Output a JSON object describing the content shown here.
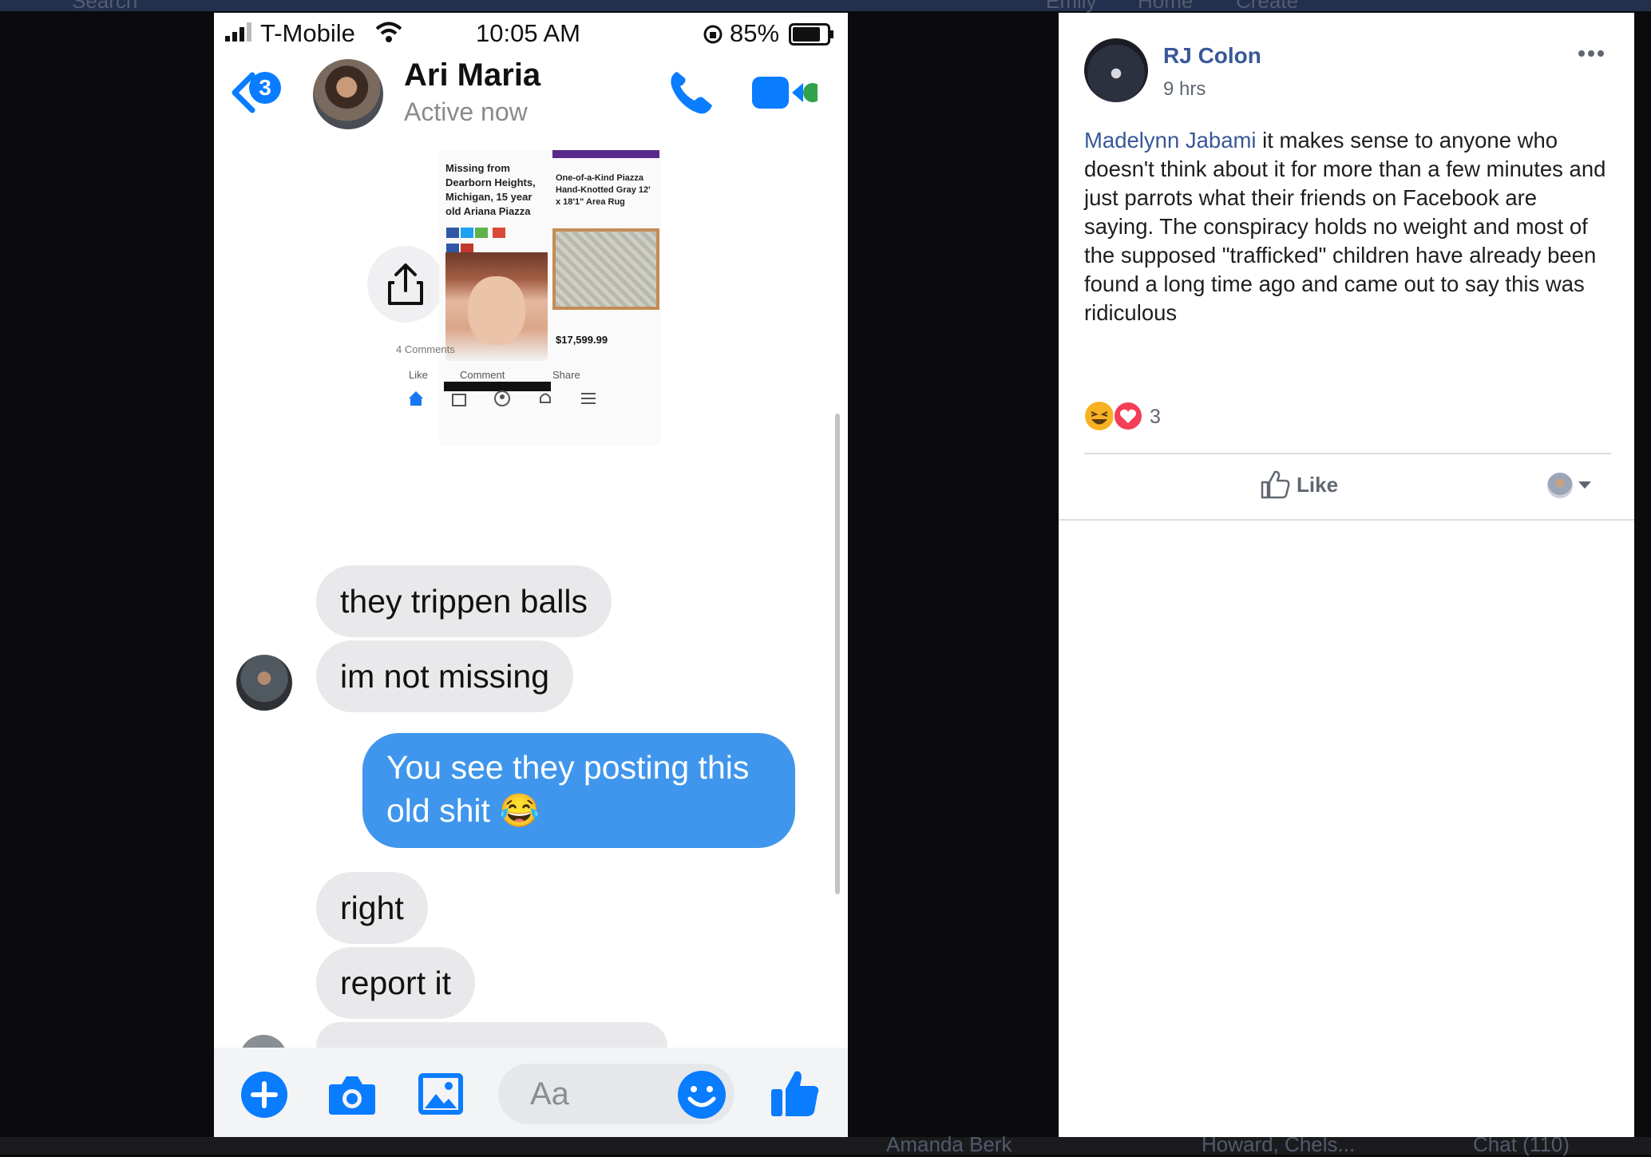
{
  "background": {
    "top_labels": [
      "Search",
      "Emily",
      "Home",
      "Create"
    ],
    "bottom_labels": [
      "Amanda Berk",
      "Howard, Chels...",
      "Chat (110)"
    ]
  },
  "phone": {
    "status": {
      "carrier": "T-Mobile",
      "time": "10:05 AM",
      "battery": "85%"
    },
    "header": {
      "back_badge": "3",
      "contact_name": "Ari Maria",
      "contact_status": "Active now"
    },
    "shared_post": {
      "left_headline": "Missing from Dearborn Heights, Michigan, 15 year old Ariana Piazza",
      "product_title": "One-of-a-Kind Piazza Hand-Knotted Gray 12' x 18'1\" Area Rug",
      "price": "$17,599.99",
      "comments": "4 Comments",
      "actions": [
        "Like",
        "Comment",
        "Share"
      ]
    },
    "messages": [
      {
        "dir": "in",
        "text": "they trippen balls"
      },
      {
        "dir": "in",
        "text": "im not missing"
      },
      {
        "dir": "out",
        "text": "You see they posting this old shit 😂"
      },
      {
        "dir": "in",
        "text": "right"
      },
      {
        "dir": "in",
        "text": "report it"
      }
    ],
    "composer": {
      "placeholder": "Aa"
    },
    "colors": {
      "accent": "#0a7cff",
      "outgoing_bubble": "#3f96ec",
      "incoming_bubble": "#e9e9eb",
      "online": "#31a24c"
    }
  },
  "fb_comment": {
    "author": "RJ Colon",
    "time": "9 hrs",
    "mention": "Madelynn Jabami",
    "text": " it makes sense to anyone who doesn't think about it for more than a few minutes and just parrots what their friends on Facebook are saying. The conspiracy holds no weight and most of the supposed \"trafficked\" children have already been found a long time ago and came out to say this was ridiculous",
    "reaction_count": "3",
    "like_label": "Like",
    "colors": {
      "link": "#385898",
      "text": "#1c1e21",
      "muted": "#606770"
    }
  }
}
